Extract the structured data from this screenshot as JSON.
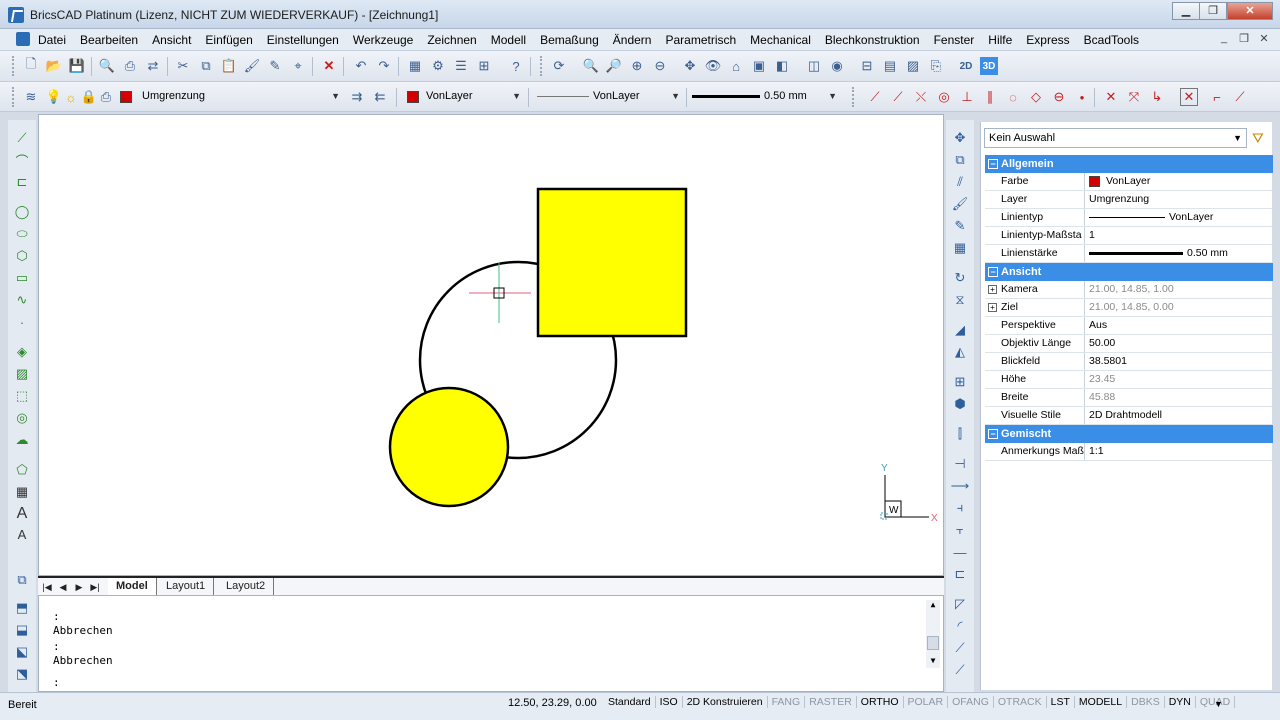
{
  "window": {
    "title": "BricsCAD Platinum (Lizenz, NICHT ZUM WIEDERVERKAUF) - [Zeichnung1]",
    "controls": [
      "minimize-icon",
      "restore-icon",
      "close-icon"
    ]
  },
  "menu": [
    "Datei",
    "Bearbeiten",
    "Ansicht",
    "Einfügen",
    "Einstellungen",
    "Werkzeuge",
    "Zeichnen",
    "Modell",
    "Bemaßung",
    "Ändern",
    "Parametrisch",
    "Mechanical",
    "Blechkonstruktion",
    "Fenster",
    "Hilfe",
    "Express",
    "BcadTools"
  ],
  "layer_toolbar": {
    "layer_name": "Umgrenzung",
    "color": "VonLayer",
    "linetype": "VonLayer",
    "lineweight": "0.50 mm"
  },
  "tabs": [
    "Model",
    "Layout1",
    "Layout2"
  ],
  "command": {
    "lines": [
      ":",
      "Abbrechen",
      ":",
      "Abbrechen"
    ],
    "prompt": ":"
  },
  "properties": {
    "selection": "Kein Auswahl",
    "sections": {
      "general": {
        "title": "Allgemein",
        "rows": {
          "farbe": {
            "name": "Farbe",
            "value": "VonLayer"
          },
          "layer": {
            "name": "Layer",
            "value": "Umgrenzung"
          },
          "linientyp": {
            "name": "Linientyp",
            "value": "VonLayer"
          },
          "scale": {
            "name": "Linientyp-Maßsta",
            "value": "1"
          },
          "weight": {
            "name": "Linienstärke",
            "value": "0.50 mm"
          }
        }
      },
      "view": {
        "title": "Ansicht",
        "rows": {
          "kamera": {
            "name": "Kamera",
            "value": "21.00, 14.85, 1.00"
          },
          "ziel": {
            "name": "Ziel",
            "value": "21.00, 14.85, 0.00"
          },
          "perspektive": {
            "name": "Perspektive",
            "value": "Aus"
          },
          "objektiv": {
            "name": "Objektiv Länge",
            "value": "50.00"
          },
          "blickfeld": {
            "name": "Blickfeld",
            "value": "38.5801"
          },
          "hoehe": {
            "name": "Höhe",
            "value": "23.45"
          },
          "breite": {
            "name": "Breite",
            "value": "45.88"
          },
          "stile": {
            "name": "Visuelle Stile",
            "value": "2D Drahtmodell"
          }
        }
      },
      "misc": {
        "title": "Gemischt",
        "rows": {
          "anmerk": {
            "name": "Anmerkungs Maß",
            "value": "1:1"
          }
        }
      }
    }
  },
  "status": {
    "ready": "Bereit",
    "coords": "12.50, 23.29, 0.00",
    "buttons": [
      {
        "label": "Standard",
        "on": true
      },
      {
        "label": "ISO",
        "on": true
      },
      {
        "label": "2D Konstruieren",
        "on": true
      },
      {
        "label": "FANG",
        "on": false
      },
      {
        "label": "RASTER",
        "on": false
      },
      {
        "label": "ORTHO",
        "on": true
      },
      {
        "label": "POLAR",
        "on": false
      },
      {
        "label": "OFANG",
        "on": false
      },
      {
        "label": "OTRACK",
        "on": false
      },
      {
        "label": "LST",
        "on": true
      },
      {
        "label": "MODELL",
        "on": true
      },
      {
        "label": "DBKS",
        "on": false
      },
      {
        "label": "DYN",
        "on": true
      },
      {
        "label": "QUAD",
        "on": false
      }
    ]
  },
  "ucs": {
    "x": "X",
    "y": "Y",
    "w": "W"
  },
  "colors": {
    "fill_yellow": "#ffff00",
    "layer_red": "#d40000",
    "section_blue": "#3a8ee6"
  }
}
